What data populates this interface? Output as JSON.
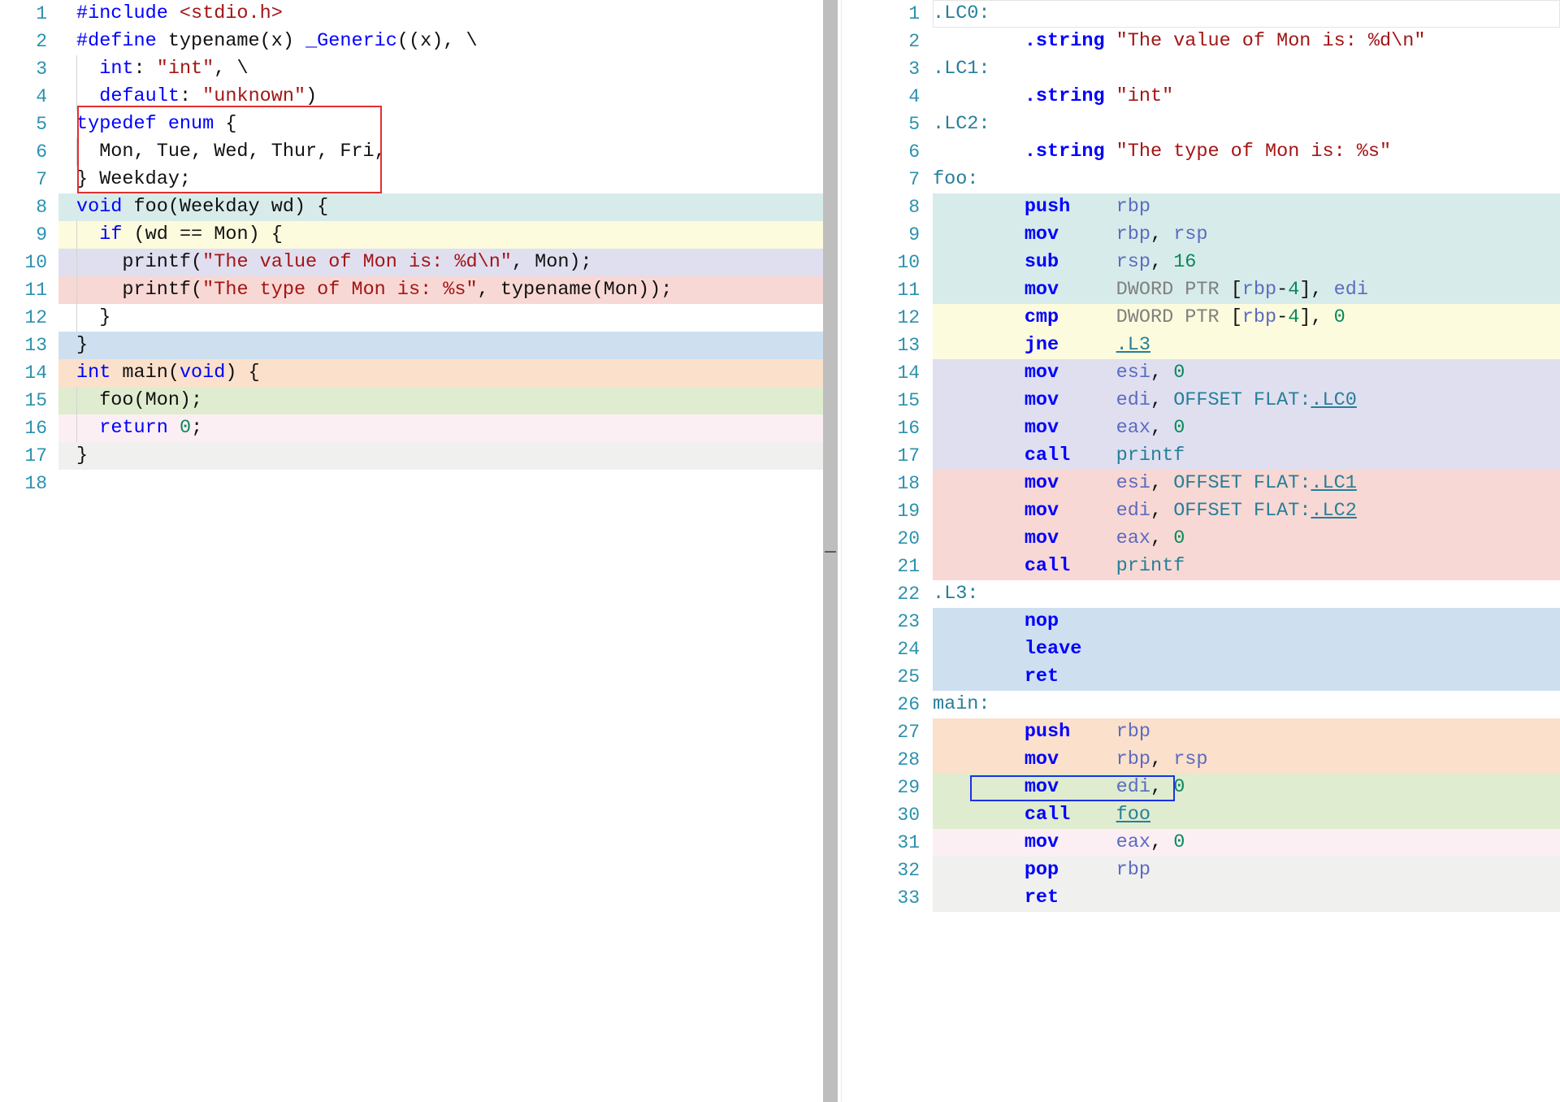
{
  "app": {
    "name": "compiler-explorer",
    "theme": "light"
  },
  "colors": {
    "keyword": "#0000ff",
    "string": "#a31515",
    "number": "#09885a",
    "label": "#267f99",
    "register": "#5c6bc0",
    "size_directive": "#808080",
    "line_number": "#2b91af",
    "source_selection_box": "#e03030",
    "asm_selection_box": "#1a32e8",
    "link_colors": [
      "#d7ecea",
      "#fcfbdd",
      "#e0dff0",
      "#f8d8d4",
      "#cedfef",
      "#fbe0cb",
      "#dfeccf",
      "#fbeff4",
      "#f0f0ee"
    ]
  },
  "source_pane": {
    "language": "c",
    "lines": [
      {
        "n": "1",
        "hl": "cw",
        "guide": false,
        "tokens": [
          {
            "t": "#include ",
            "c": "pre"
          },
          {
            "t": "<stdio.h>",
            "c": "str"
          }
        ]
      },
      {
        "n": "2",
        "hl": "cw",
        "guide": false,
        "tokens": [
          {
            "t": "#define",
            "c": "pre"
          },
          {
            "t": " typename(x) ",
            "c": "pl"
          },
          {
            "t": "_Generic",
            "c": "k"
          },
          {
            "t": "((x), \\",
            "c": "pl"
          }
        ]
      },
      {
        "n": "3",
        "hl": "cw",
        "guide": true,
        "tokens": [
          {
            "t": "  ",
            "c": "pl"
          },
          {
            "t": "int",
            "c": "k"
          },
          {
            "t": ": ",
            "c": "pl"
          },
          {
            "t": "\"int\"",
            "c": "str"
          },
          {
            "t": ", \\",
            "c": "pl"
          }
        ]
      },
      {
        "n": "4",
        "hl": "cw",
        "guide": true,
        "tokens": [
          {
            "t": "  ",
            "c": "pl"
          },
          {
            "t": "default",
            "c": "k"
          },
          {
            "t": ": ",
            "c": "pl"
          },
          {
            "t": "\"unknown\"",
            "c": "str"
          },
          {
            "t": ")",
            "c": "pl"
          }
        ]
      },
      {
        "n": "5",
        "hl": "cw",
        "guide": false,
        "tokens": [
          {
            "t": "typedef enum",
            "c": "k"
          },
          {
            "t": " {",
            "c": "pl"
          }
        ]
      },
      {
        "n": "6",
        "hl": "cw",
        "guide": true,
        "tokens": [
          {
            "t": "  Mon, Tue, Wed, Thur, Fri,",
            "c": "pl"
          }
        ]
      },
      {
        "n": "7",
        "hl": "cw",
        "guide": false,
        "tokens": [
          {
            "t": "} Weekday;",
            "c": "pl"
          }
        ]
      },
      {
        "n": "8",
        "hl": "c0",
        "guide": false,
        "tokens": [
          {
            "t": "void",
            "c": "k"
          },
          {
            "t": " foo(Weekday wd) {",
            "c": "pl"
          }
        ]
      },
      {
        "n": "9",
        "hl": "c1",
        "guide": true,
        "tokens": [
          {
            "t": "  ",
            "c": "pl"
          },
          {
            "t": "if",
            "c": "k"
          },
          {
            "t": " (wd == Mon) {",
            "c": "pl"
          }
        ]
      },
      {
        "n": "10",
        "hl": "c2",
        "guide": true,
        "tokens": [
          {
            "t": "    printf(",
            "c": "pl"
          },
          {
            "t": "\"The value of Mon is: %d\\n\"",
            "c": "str"
          },
          {
            "t": ", Mon);",
            "c": "pl"
          }
        ]
      },
      {
        "n": "11",
        "hl": "c3",
        "guide": true,
        "tokens": [
          {
            "t": "    printf(",
            "c": "pl"
          },
          {
            "t": "\"The type of Mon is: %s\"",
            "c": "str"
          },
          {
            "t": ", typename(Mon));",
            "c": "pl"
          }
        ]
      },
      {
        "n": "12",
        "hl": "cw",
        "guide": true,
        "tokens": [
          {
            "t": "  }",
            "c": "pl"
          }
        ]
      },
      {
        "n": "13",
        "hl": "c4",
        "guide": false,
        "tokens": [
          {
            "t": "}",
            "c": "pl"
          }
        ]
      },
      {
        "n": "14",
        "hl": "c5",
        "guide": false,
        "tokens": [
          {
            "t": "int",
            "c": "k"
          },
          {
            "t": " main(",
            "c": "pl"
          },
          {
            "t": "void",
            "c": "k"
          },
          {
            "t": ") {",
            "c": "pl"
          }
        ]
      },
      {
        "n": "15",
        "hl": "c6",
        "guide": true,
        "tokens": [
          {
            "t": "  foo(Mon);",
            "c": "pl"
          }
        ]
      },
      {
        "n": "16",
        "hl": "c7",
        "guide": true,
        "tokens": [
          {
            "t": "  ",
            "c": "pl"
          },
          {
            "t": "return",
            "c": "k"
          },
          {
            "t": " ",
            "c": "pl"
          },
          {
            "t": "0",
            "c": "num"
          },
          {
            "t": ";",
            "c": "pl"
          }
        ]
      },
      {
        "n": "17",
        "hl": "c8",
        "guide": false,
        "tokens": [
          {
            "t": "}",
            "c": "pl"
          }
        ]
      },
      {
        "n": "18",
        "hl": "cw",
        "guide": false,
        "tokens": [
          {
            "t": "",
            "c": "pl"
          }
        ]
      }
    ],
    "selection_box": {
      "first_line": 5,
      "last_line": 7,
      "label": "typedef-enum-selection"
    }
  },
  "asm_pane": {
    "language": "x86-64 asm (Intel syntax)",
    "lines": [
      {
        "n": "1",
        "hl": "cw",
        "tokens": [
          {
            "t": ".LC0:",
            "c": "lbl"
          }
        ]
      },
      {
        "n": "2",
        "hl": "cw",
        "tokens": [
          {
            "t": "        ",
            "c": "pl"
          },
          {
            "t": ".string",
            "c": "ins"
          },
          {
            "t": " ",
            "c": "pl"
          },
          {
            "t": "\"The value of Mon is: %d\\n\"",
            "c": "str"
          }
        ]
      },
      {
        "n": "3",
        "hl": "cw",
        "tokens": [
          {
            "t": ".LC1:",
            "c": "lbl"
          }
        ]
      },
      {
        "n": "4",
        "hl": "cw",
        "tokens": [
          {
            "t": "        ",
            "c": "pl"
          },
          {
            "t": ".string",
            "c": "ins"
          },
          {
            "t": " ",
            "c": "pl"
          },
          {
            "t": "\"int\"",
            "c": "str"
          }
        ]
      },
      {
        "n": "5",
        "hl": "cw",
        "tokens": [
          {
            "t": ".LC2:",
            "c": "lbl"
          }
        ]
      },
      {
        "n": "6",
        "hl": "cw",
        "tokens": [
          {
            "t": "        ",
            "c": "pl"
          },
          {
            "t": ".string",
            "c": "ins"
          },
          {
            "t": " ",
            "c": "pl"
          },
          {
            "t": "\"The type of Mon is: %s\"",
            "c": "str"
          }
        ]
      },
      {
        "n": "7",
        "hl": "cw",
        "tokens": [
          {
            "t": "foo:",
            "c": "lbl"
          }
        ]
      },
      {
        "n": "8",
        "hl": "c0",
        "tokens": [
          {
            "t": "        ",
            "c": "pl"
          },
          {
            "t": "push",
            "c": "ins"
          },
          {
            "t": "    ",
            "c": "pl"
          },
          {
            "t": "rbp",
            "c": "reg"
          }
        ]
      },
      {
        "n": "9",
        "hl": "c0",
        "tokens": [
          {
            "t": "        ",
            "c": "pl"
          },
          {
            "t": "mov",
            "c": "ins"
          },
          {
            "t": "     ",
            "c": "pl"
          },
          {
            "t": "rbp",
            "c": "reg"
          },
          {
            "t": ", ",
            "c": "pl"
          },
          {
            "t": "rsp",
            "c": "reg"
          }
        ]
      },
      {
        "n": "10",
        "hl": "c0",
        "tokens": [
          {
            "t": "        ",
            "c": "pl"
          },
          {
            "t": "sub",
            "c": "ins"
          },
          {
            "t": "     ",
            "c": "pl"
          },
          {
            "t": "rsp",
            "c": "reg"
          },
          {
            "t": ", ",
            "c": "pl"
          },
          {
            "t": "16",
            "c": "num"
          }
        ]
      },
      {
        "n": "11",
        "hl": "c0",
        "tokens": [
          {
            "t": "        ",
            "c": "pl"
          },
          {
            "t": "mov",
            "c": "ins"
          },
          {
            "t": "     ",
            "c": "pl"
          },
          {
            "t": "DWORD PTR ",
            "c": "siz"
          },
          {
            "t": "[",
            "c": "pl"
          },
          {
            "t": "rbp",
            "c": "reg"
          },
          {
            "t": "-",
            "c": "pl"
          },
          {
            "t": "4",
            "c": "num"
          },
          {
            "t": "], ",
            "c": "pl"
          },
          {
            "t": "edi",
            "c": "reg"
          }
        ]
      },
      {
        "n": "12",
        "hl": "c1",
        "tokens": [
          {
            "t": "        ",
            "c": "pl"
          },
          {
            "t": "cmp",
            "c": "ins"
          },
          {
            "t": "     ",
            "c": "pl"
          },
          {
            "t": "DWORD PTR ",
            "c": "siz"
          },
          {
            "t": "[",
            "c": "pl"
          },
          {
            "t": "rbp",
            "c": "reg"
          },
          {
            "t": "-",
            "c": "pl"
          },
          {
            "t": "4",
            "c": "num"
          },
          {
            "t": "], ",
            "c": "pl"
          },
          {
            "t": "0",
            "c": "num"
          }
        ]
      },
      {
        "n": "13",
        "hl": "c1",
        "tokens": [
          {
            "t": "        ",
            "c": "pl"
          },
          {
            "t": "jne",
            "c": "ins"
          },
          {
            "t": "     ",
            "c": "pl"
          },
          {
            "t": ".L3",
            "c": "lnk"
          }
        ]
      },
      {
        "n": "14",
        "hl": "c2",
        "tokens": [
          {
            "t": "        ",
            "c": "pl"
          },
          {
            "t": "mov",
            "c": "ins"
          },
          {
            "t": "     ",
            "c": "pl"
          },
          {
            "t": "esi",
            "c": "reg"
          },
          {
            "t": ", ",
            "c": "pl"
          },
          {
            "t": "0",
            "c": "num"
          }
        ]
      },
      {
        "n": "15",
        "hl": "c2",
        "tokens": [
          {
            "t": "        ",
            "c": "pl"
          },
          {
            "t": "mov",
            "c": "ins"
          },
          {
            "t": "     ",
            "c": "pl"
          },
          {
            "t": "edi",
            "c": "reg"
          },
          {
            "t": ", ",
            "c": "pl"
          },
          {
            "t": "OFFSET FLAT:",
            "c": "lbl"
          },
          {
            "t": ".LC0",
            "c": "lnk"
          }
        ]
      },
      {
        "n": "16",
        "hl": "c2",
        "tokens": [
          {
            "t": "        ",
            "c": "pl"
          },
          {
            "t": "mov",
            "c": "ins"
          },
          {
            "t": "     ",
            "c": "pl"
          },
          {
            "t": "eax",
            "c": "reg"
          },
          {
            "t": ", ",
            "c": "pl"
          },
          {
            "t": "0",
            "c": "num"
          }
        ]
      },
      {
        "n": "17",
        "hl": "c2",
        "tokens": [
          {
            "t": "        ",
            "c": "pl"
          },
          {
            "t": "call",
            "c": "ins"
          },
          {
            "t": "    ",
            "c": "pl"
          },
          {
            "t": "printf",
            "c": "lbl"
          }
        ]
      },
      {
        "n": "18",
        "hl": "c3",
        "tokens": [
          {
            "t": "        ",
            "c": "pl"
          },
          {
            "t": "mov",
            "c": "ins"
          },
          {
            "t": "     ",
            "c": "pl"
          },
          {
            "t": "esi",
            "c": "reg"
          },
          {
            "t": ", ",
            "c": "pl"
          },
          {
            "t": "OFFSET FLAT:",
            "c": "lbl"
          },
          {
            "t": ".LC1",
            "c": "lnk"
          }
        ]
      },
      {
        "n": "19",
        "hl": "c3",
        "tokens": [
          {
            "t": "        ",
            "c": "pl"
          },
          {
            "t": "mov",
            "c": "ins"
          },
          {
            "t": "     ",
            "c": "pl"
          },
          {
            "t": "edi",
            "c": "reg"
          },
          {
            "t": ", ",
            "c": "pl"
          },
          {
            "t": "OFFSET FLAT:",
            "c": "lbl"
          },
          {
            "t": ".LC2",
            "c": "lnk"
          }
        ]
      },
      {
        "n": "20",
        "hl": "c3",
        "tokens": [
          {
            "t": "        ",
            "c": "pl"
          },
          {
            "t": "mov",
            "c": "ins"
          },
          {
            "t": "     ",
            "c": "pl"
          },
          {
            "t": "eax",
            "c": "reg"
          },
          {
            "t": ", ",
            "c": "pl"
          },
          {
            "t": "0",
            "c": "num"
          }
        ]
      },
      {
        "n": "21",
        "hl": "c3",
        "tokens": [
          {
            "t": "        ",
            "c": "pl"
          },
          {
            "t": "call",
            "c": "ins"
          },
          {
            "t": "    ",
            "c": "pl"
          },
          {
            "t": "printf",
            "c": "lbl"
          }
        ]
      },
      {
        "n": "22",
        "hl": "cw",
        "tokens": [
          {
            "t": ".L3:",
            "c": "lbl"
          }
        ]
      },
      {
        "n": "23",
        "hl": "c4",
        "tokens": [
          {
            "t": "        ",
            "c": "pl"
          },
          {
            "t": "nop",
            "c": "ins"
          }
        ]
      },
      {
        "n": "24",
        "hl": "c4",
        "tokens": [
          {
            "t": "        ",
            "c": "pl"
          },
          {
            "t": "leave",
            "c": "ins"
          }
        ]
      },
      {
        "n": "25",
        "hl": "c4",
        "tokens": [
          {
            "t": "        ",
            "c": "pl"
          },
          {
            "t": "ret",
            "c": "ins"
          }
        ]
      },
      {
        "n": "26",
        "hl": "cw",
        "tokens": [
          {
            "t": "main:",
            "c": "lbl"
          }
        ]
      },
      {
        "n": "27",
        "hl": "c5",
        "tokens": [
          {
            "t": "        ",
            "c": "pl"
          },
          {
            "t": "push",
            "c": "ins"
          },
          {
            "t": "    ",
            "c": "pl"
          },
          {
            "t": "rbp",
            "c": "reg"
          }
        ]
      },
      {
        "n": "28",
        "hl": "c5",
        "tokens": [
          {
            "t": "        ",
            "c": "pl"
          },
          {
            "t": "mov",
            "c": "ins"
          },
          {
            "t": "     ",
            "c": "pl"
          },
          {
            "t": "rbp",
            "c": "reg"
          },
          {
            "t": ", ",
            "c": "pl"
          },
          {
            "t": "rsp",
            "c": "reg"
          }
        ]
      },
      {
        "n": "29",
        "hl": "c6",
        "tokens": [
          {
            "t": "        ",
            "c": "pl"
          },
          {
            "t": "mov",
            "c": "ins"
          },
          {
            "t": "     ",
            "c": "pl"
          },
          {
            "t": "edi",
            "c": "reg"
          },
          {
            "t": ", ",
            "c": "pl"
          },
          {
            "t": "0",
            "c": "num"
          }
        ]
      },
      {
        "n": "30",
        "hl": "c6",
        "tokens": [
          {
            "t": "        ",
            "c": "pl"
          },
          {
            "t": "call",
            "c": "ins"
          },
          {
            "t": "    ",
            "c": "pl"
          },
          {
            "t": "foo",
            "c": "lnk"
          }
        ]
      },
      {
        "n": "31",
        "hl": "c7",
        "tokens": [
          {
            "t": "        ",
            "c": "pl"
          },
          {
            "t": "mov",
            "c": "ins"
          },
          {
            "t": "     ",
            "c": "pl"
          },
          {
            "t": "eax",
            "c": "reg"
          },
          {
            "t": ", ",
            "c": "pl"
          },
          {
            "t": "0",
            "c": "num"
          }
        ]
      },
      {
        "n": "32",
        "hl": "c8",
        "tokens": [
          {
            "t": "        ",
            "c": "pl"
          },
          {
            "t": "pop",
            "c": "ins"
          },
          {
            "t": "     ",
            "c": "pl"
          },
          {
            "t": "rbp",
            "c": "reg"
          }
        ]
      },
      {
        "n": "33",
        "hl": "c8",
        "tokens": [
          {
            "t": "        ",
            "c": "pl"
          },
          {
            "t": "ret",
            "c": "ins"
          }
        ]
      }
    ],
    "selection_box": {
      "line": 29,
      "text": "mov     edi, 0",
      "label": "mov-edi-0-selection"
    }
  },
  "scrollbars": {
    "source_vertical": {
      "thumb_top_pct": 0,
      "thumb_height_pct": 100
    },
    "asm_vertical": {
      "thumb_top_pct": 0,
      "thumb_height_pct": 90
    }
  }
}
